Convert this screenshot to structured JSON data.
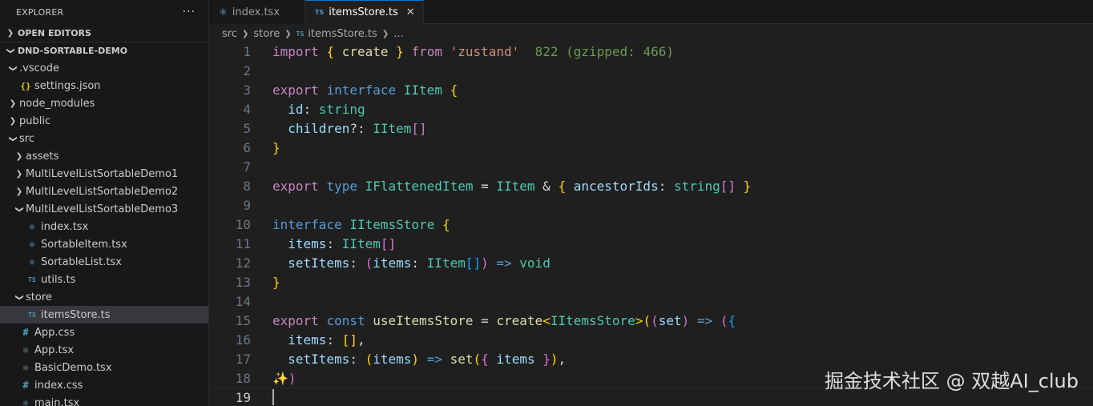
{
  "explorer": {
    "title": "EXPLORER",
    "more": "···",
    "open_editors": "OPEN EDITORS",
    "project": "DND-SORTABLE-DEMO",
    "tree": [
      {
        "label": ".vscode",
        "kind": "folder-open",
        "depth": 1
      },
      {
        "label": "settings.json",
        "kind": "json",
        "depth": 2
      },
      {
        "label": "node_modules",
        "kind": "folder-closed",
        "depth": 1
      },
      {
        "label": "public",
        "kind": "folder-closed",
        "depth": 1
      },
      {
        "label": "src",
        "kind": "folder-open",
        "depth": 1
      },
      {
        "label": "assets",
        "kind": "folder-closed",
        "depth": 2
      },
      {
        "label": "MultiLevelListSortableDemo1",
        "kind": "folder-closed",
        "depth": 2
      },
      {
        "label": "MultiLevelListSortableDemo2",
        "kind": "folder-closed",
        "depth": 2
      },
      {
        "label": "MultiLevelListSortableDemo3",
        "kind": "folder-open",
        "depth": 2
      },
      {
        "label": "index.tsx",
        "kind": "react",
        "depth": 3
      },
      {
        "label": "SortableItem.tsx",
        "kind": "react",
        "depth": 3
      },
      {
        "label": "SortableList.tsx",
        "kind": "react",
        "depth": 3
      },
      {
        "label": "utils.ts",
        "kind": "ts",
        "depth": 3
      },
      {
        "label": "store",
        "kind": "folder-open",
        "depth": 2
      },
      {
        "label": "itemsStore.ts",
        "kind": "ts",
        "depth": 3,
        "selected": true
      },
      {
        "label": "App.css",
        "kind": "css",
        "depth": 2
      },
      {
        "label": "App.tsx",
        "kind": "react",
        "depth": 2
      },
      {
        "label": "BasicDemo.tsx",
        "kind": "react",
        "depth": 2
      },
      {
        "label": "index.css",
        "kind": "css",
        "depth": 2
      },
      {
        "label": "main.tsx",
        "kind": "react",
        "depth": 2
      }
    ]
  },
  "icons": {
    "ts": "TS",
    "css": "#",
    "json": "{}",
    "react": "⚛"
  },
  "tabs": [
    {
      "label": "index.tsx",
      "kind": "react",
      "active": false
    },
    {
      "label": "itemsStore.ts",
      "kind": "ts",
      "active": true,
      "close": "✕"
    }
  ],
  "breadcrumb": {
    "parts": [
      "src",
      "store",
      "itemsStore.ts",
      "..."
    ]
  },
  "code": {
    "current_line": 19,
    "line_numbers": [
      "1",
      "2",
      "3",
      "4",
      "5",
      "6",
      "7",
      "8",
      "9",
      "10",
      "11",
      "12",
      "13",
      "14",
      "15",
      "16",
      "17",
      "18",
      "19"
    ],
    "lines": [
      [
        [
          "kw",
          "import"
        ],
        [
          "op",
          " "
        ],
        [
          "br1",
          "{"
        ],
        [
          "op",
          " "
        ],
        [
          "fn",
          "create"
        ],
        [
          "op",
          " "
        ],
        [
          "br1",
          "}"
        ],
        [
          "op",
          " "
        ],
        [
          "kw",
          "from"
        ],
        [
          "op",
          " "
        ],
        [
          "st",
          "'zustand'"
        ],
        [
          "op",
          "  "
        ],
        [
          "hint",
          "822 (gzipped: 466)"
        ]
      ],
      [],
      [
        [
          "kw",
          "export"
        ],
        [
          "op",
          " "
        ],
        [
          "kw2",
          "interface"
        ],
        [
          "op",
          " "
        ],
        [
          "ty",
          "IItem"
        ],
        [
          "op",
          " "
        ],
        [
          "br1",
          "{"
        ]
      ],
      [
        [
          "op",
          "  "
        ],
        [
          "id",
          "id"
        ],
        [
          "op",
          ": "
        ],
        [
          "ty",
          "string"
        ]
      ],
      [
        [
          "op",
          "  "
        ],
        [
          "id",
          "children"
        ],
        [
          "op",
          "?: "
        ],
        [
          "ty",
          "IItem"
        ],
        [
          "br2",
          "[]"
        ]
      ],
      [
        [
          "br1",
          "}"
        ]
      ],
      [],
      [
        [
          "kw",
          "export"
        ],
        [
          "op",
          " "
        ],
        [
          "kw2",
          "type"
        ],
        [
          "op",
          " "
        ],
        [
          "ty",
          "IFlattenedItem"
        ],
        [
          "op",
          " = "
        ],
        [
          "ty",
          "IItem"
        ],
        [
          "op",
          " & "
        ],
        [
          "br1",
          "{"
        ],
        [
          "op",
          " "
        ],
        [
          "id",
          "ancestorIds"
        ],
        [
          "op",
          ": "
        ],
        [
          "ty",
          "string"
        ],
        [
          "br2",
          "[]"
        ],
        [
          "op",
          " "
        ],
        [
          "br1",
          "}"
        ]
      ],
      [],
      [
        [
          "kw2",
          "interface"
        ],
        [
          "op",
          " "
        ],
        [
          "ty",
          "IItemsStore"
        ],
        [
          "op",
          " "
        ],
        [
          "br1",
          "{"
        ]
      ],
      [
        [
          "op",
          "  "
        ],
        [
          "id",
          "items"
        ],
        [
          "op",
          ": "
        ],
        [
          "ty",
          "IItem"
        ],
        [
          "br2",
          "[]"
        ]
      ],
      [
        [
          "op",
          "  "
        ],
        [
          "id",
          "setItems"
        ],
        [
          "op",
          ": "
        ],
        [
          "br2",
          "("
        ],
        [
          "id",
          "items"
        ],
        [
          "op",
          ": "
        ],
        [
          "ty",
          "IItem"
        ],
        [
          "br3",
          "[]"
        ],
        [
          "br2",
          ")"
        ],
        [
          "op",
          " "
        ],
        [
          "kw2",
          "=>"
        ],
        [
          "op",
          " "
        ],
        [
          "ty",
          "void"
        ]
      ],
      [
        [
          "br1",
          "}"
        ]
      ],
      [],
      [
        [
          "kw",
          "export"
        ],
        [
          "op",
          " "
        ],
        [
          "kw2",
          "const"
        ],
        [
          "op",
          " "
        ],
        [
          "fn",
          "useItemsStore"
        ],
        [
          "op",
          " = "
        ],
        [
          "fn",
          "create"
        ],
        [
          "br1",
          "<"
        ],
        [
          "ty",
          "IItemsStore"
        ],
        [
          "br1",
          ">"
        ],
        [
          "br1",
          "("
        ],
        [
          "br2",
          "("
        ],
        [
          "id",
          "set"
        ],
        [
          "br2",
          ")"
        ],
        [
          "op",
          " "
        ],
        [
          "kw2",
          "=>"
        ],
        [
          "op",
          " "
        ],
        [
          "br2",
          "("
        ],
        [
          "br3",
          "{"
        ]
      ],
      [
        [
          "op",
          "  "
        ],
        [
          "id",
          "items"
        ],
        [
          "op",
          ": "
        ],
        [
          "br1",
          "[]"
        ],
        [
          "op",
          ","
        ]
      ],
      [
        [
          "op",
          "  "
        ],
        [
          "id",
          "setItems"
        ],
        [
          "op",
          ": "
        ],
        [
          "br1",
          "("
        ],
        [
          "id",
          "items"
        ],
        [
          "br1",
          ")"
        ],
        [
          "op",
          " "
        ],
        [
          "kw2",
          "=>"
        ],
        [
          "op",
          " "
        ],
        [
          "fn",
          "set"
        ],
        [
          "br1",
          "("
        ],
        [
          "br2",
          "{"
        ],
        [
          "op",
          " "
        ],
        [
          "id",
          "items"
        ],
        [
          "op",
          " "
        ],
        [
          "br2",
          "}"
        ],
        [
          "br1",
          ")"
        ],
        [
          "op",
          ","
        ]
      ],
      [
        [
          "sparkle",
          "✨"
        ],
        [
          "br2",
          ")"
        ]
      ],
      [
        [
          "cursor",
          ""
        ]
      ]
    ]
  },
  "watermark": "掘金技术社区 @ 双越AI_club"
}
